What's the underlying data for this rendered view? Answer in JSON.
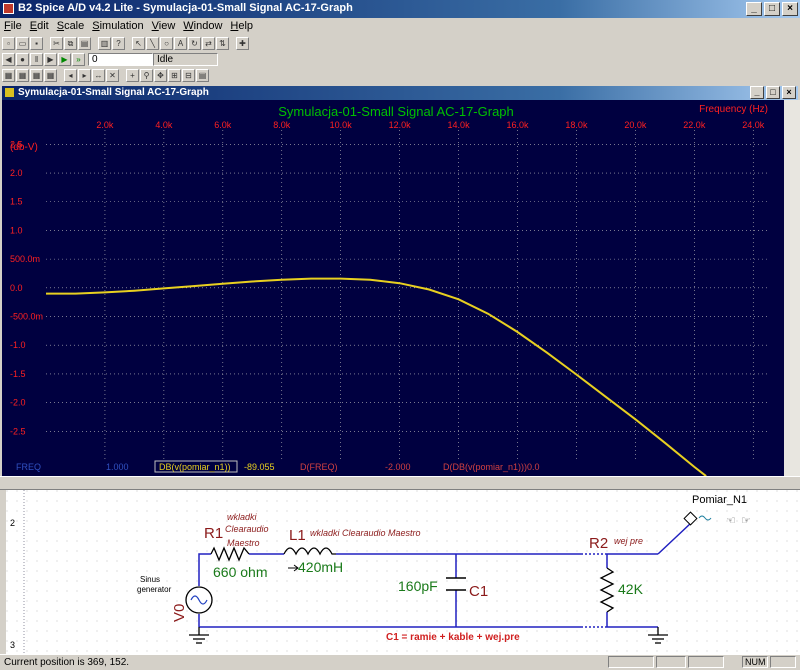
{
  "window": {
    "title": "B2 Spice A/D v4.2 Lite - Symulacja-01-Small Signal AC-17-Graph"
  },
  "menu": [
    "File",
    "Edit",
    "Scale",
    "Simulation",
    "View",
    "Window",
    "Help"
  ],
  "toolbar": {
    "step_value": "0",
    "status": "Idle"
  },
  "graph_window": {
    "title": "Symulacja-01-Small Signal AC-17-Graph"
  },
  "colors": {
    "plot_bg": "#000040",
    "grid": "#c0c0c0",
    "curve": "#e8d020",
    "axis_label": "#ff2020",
    "title": "#00c000",
    "cursor_label": "#d04040"
  },
  "cursor_bar": {
    "freq_label": "FREQ",
    "freq_value": "1.000",
    "trace_label": "DB(v(pomiar_n1))",
    "trace_value": "-89.055",
    "dfreq_label": "D(FREQ)",
    "dfreq_value": "-2.000",
    "dtrace_label": "D(DB(v(pomiar_n1)))",
    "dtrace_value": "0.0"
  },
  "chart_data": {
    "type": "line",
    "title": "Symulacja-01-Small Signal AC-17-Graph",
    "xlabel": "Frequency  (Hz)",
    "ylabel": "(db-V)",
    "x_ticks": [
      "2.0k",
      "4.0k",
      "6.0k",
      "8.0k",
      "10.0k",
      "12.0k",
      "14.0k",
      "16.0k",
      "18.0k",
      "20.0k",
      "22.0k",
      "24.0k"
    ],
    "y_ticks": [
      "2.5",
      "2.0",
      "1.5",
      "1.0",
      "500.0m",
      "0.0",
      "-500.0m",
      "-1.0",
      "-1.5",
      "-2.0",
      "-2.5"
    ],
    "xlim": [
      0,
      24500
    ],
    "ylim": [
      -3.0,
      2.75
    ],
    "grid": true,
    "series": [
      {
        "x": [
          0,
          1000,
          2000,
          3000,
          4000,
          5000,
          6000,
          7000,
          8000,
          9000,
          10000,
          11000,
          12000,
          13000,
          14000,
          15000,
          16000,
          17000,
          18000,
          19000,
          20000,
          21000,
          22000,
          22400
        ],
        "y": [
          -0.1,
          -0.1,
          -0.08,
          -0.05,
          -0.01,
          0.03,
          0.07,
          0.11,
          0.14,
          0.16,
          0.16,
          0.14,
          0.08,
          -0.03,
          -0.2,
          -0.45,
          -0.77,
          -1.13,
          -1.51,
          -1.9,
          -2.29,
          -2.7,
          -3.12,
          -3.28
        ]
      }
    ]
  },
  "schematic": {
    "row_labels": [
      "2",
      "3"
    ],
    "r1": {
      "name": "R1",
      "desc1": "wkladki",
      "desc2": "Clearaudio",
      "desc3": "Maestro",
      "value": "660 ohm"
    },
    "l1": {
      "name": "L1",
      "desc": "wkladki Clearaudio Maestro",
      "value": "420mH"
    },
    "c1": {
      "name": "C1",
      "value": "160pF"
    },
    "r2": {
      "name": "R2",
      "desc": "wej pre",
      "value": "42K"
    },
    "v0": {
      "name": "V0",
      "desc1": "Sinus",
      "desc2": "generator"
    },
    "probe": {
      "name": "Pomiar_N1"
    },
    "note": "C1 = ramie + kable + wej.pre"
  },
  "status": {
    "message": "Current position is 369, 152.",
    "num": "NUM"
  }
}
